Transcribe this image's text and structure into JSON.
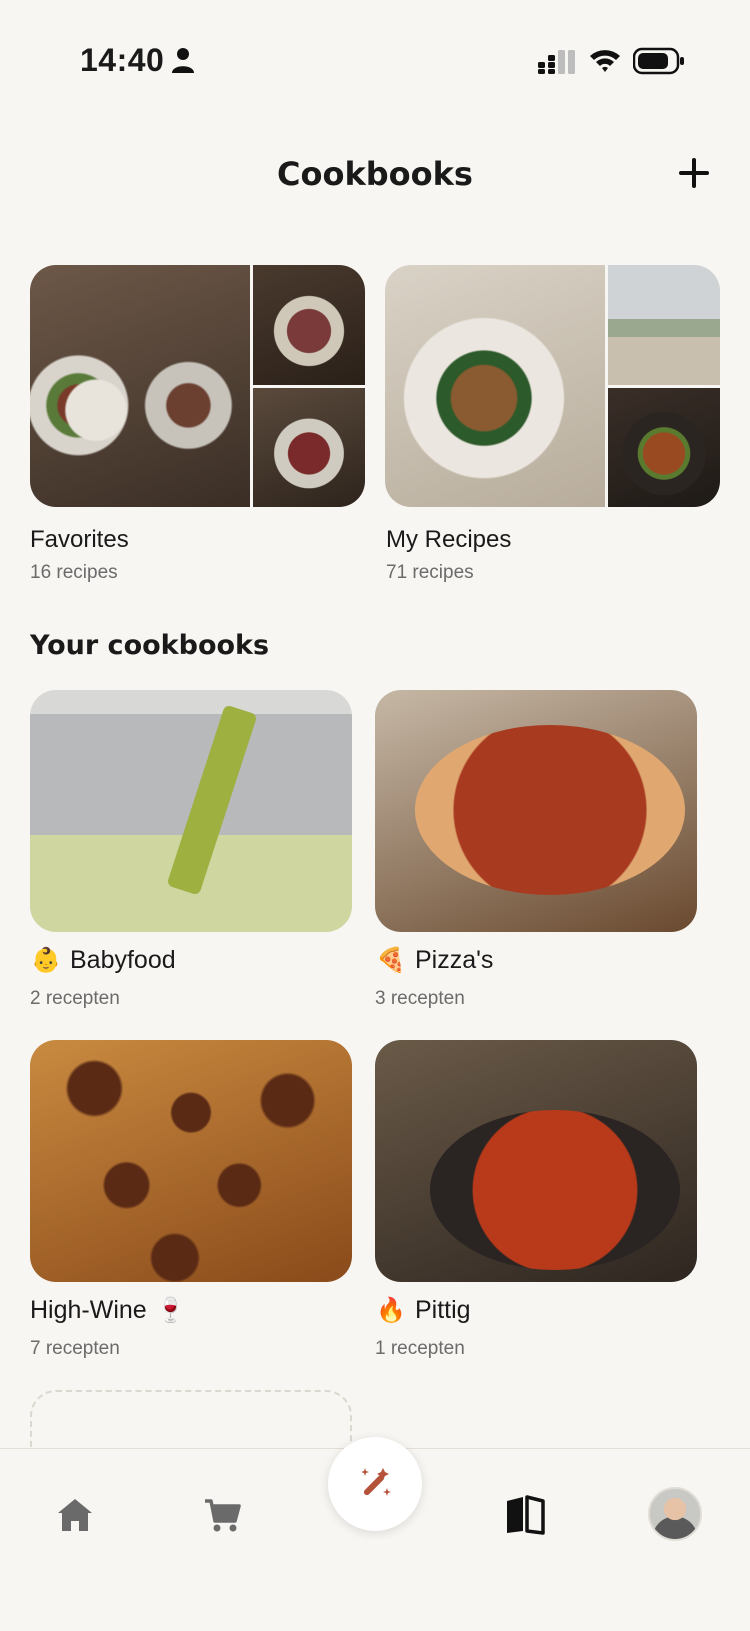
{
  "status_bar": {
    "time": "14:40"
  },
  "header": {
    "title": "Cookbooks"
  },
  "collections": [
    {
      "title": "Favorites",
      "count": "16 recipes"
    },
    {
      "title": "My Recipes",
      "count": "71 recipes"
    }
  ],
  "section": {
    "title": "Your cookbooks"
  },
  "cookbooks": [
    {
      "emoji": "👶",
      "title": "Babyfood",
      "count": "2 recepten"
    },
    {
      "emoji": "🍕",
      "title": "Pizza's",
      "count": "3 recepten"
    },
    {
      "title": "High-Wine",
      "emoji": "🍷",
      "count": "7 recepten"
    },
    {
      "emoji": "🔥",
      "title": "Pittig",
      "count": "1 recepten"
    }
  ],
  "tab_bar": {
    "items": [
      "home-icon",
      "cart-icon",
      "magic-wand-icon",
      "book-icon",
      "avatar"
    ],
    "accent": "#b5533a",
    "active": "book-icon"
  },
  "colors": {
    "background": "#f8f6f2",
    "text": "#1a1a1a",
    "muted": "#6b6b6b"
  }
}
